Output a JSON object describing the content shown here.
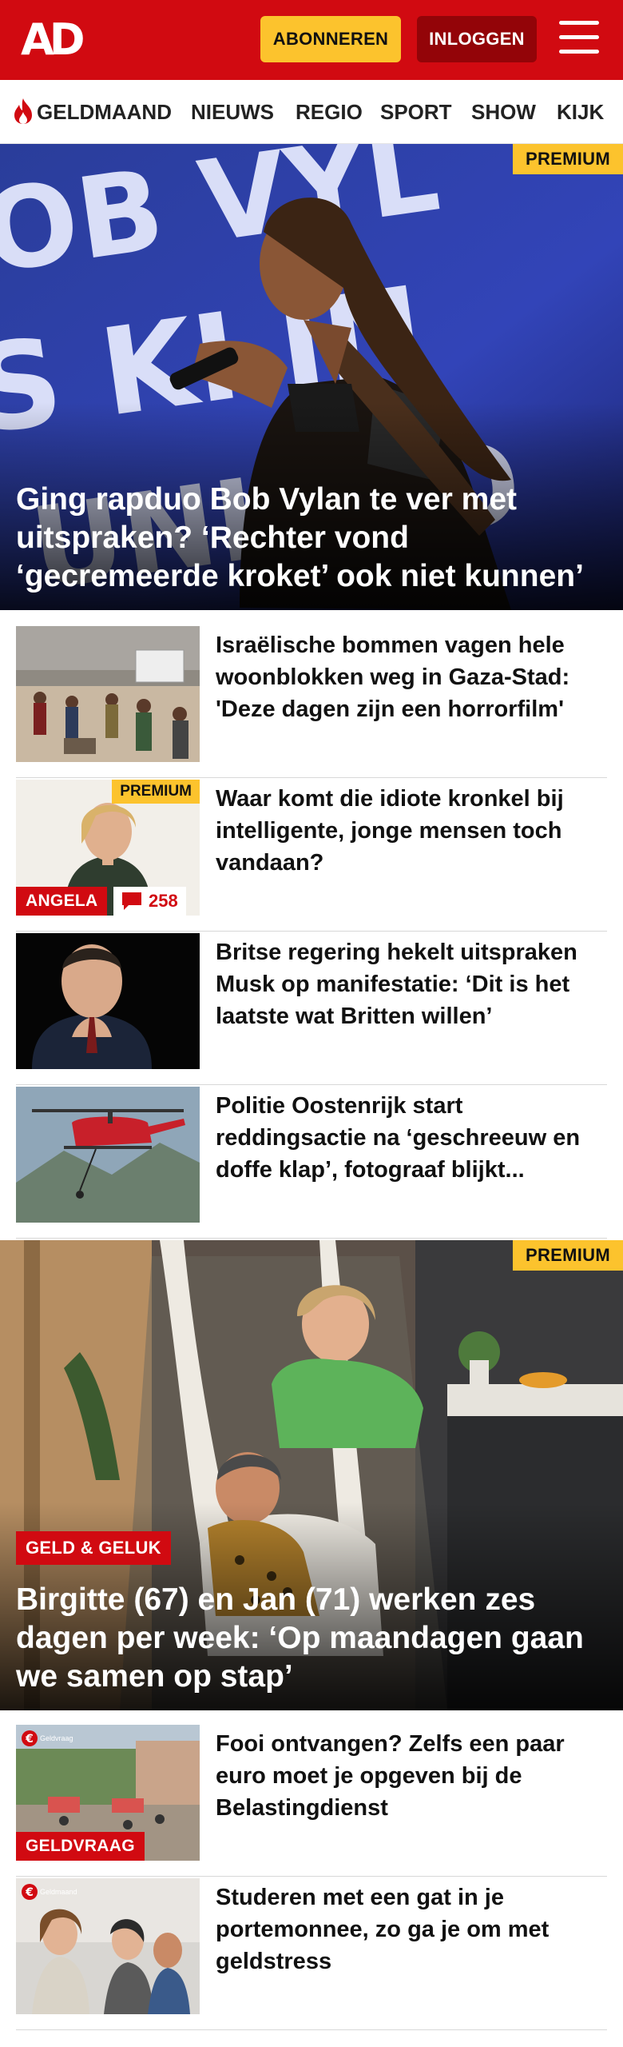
{
  "header": {
    "logo": "AD",
    "subscribe_label": "ABONNEREN",
    "login_label": "INLOGGEN"
  },
  "nav": {
    "items": [
      "GELDMAAND",
      "NIEUWS",
      "REGIO",
      "SPORT",
      "SHOW",
      "KIJK"
    ]
  },
  "hero1": {
    "badge": "PREMIUM",
    "title": "Ging rapduo Bob Vylan te ver met uitspraken? ‘Rechter vond ‘gecremeerde kroket’ ook niet kunnen’",
    "image_text": "BOB VYLAN IS KILLING PUNK ROCK"
  },
  "articles": [
    {
      "title": "Israëlische bommen vagen hele woonblokken weg in Gaza-Stad: 'Deze dagen zijn een horrorfilm'"
    },
    {
      "title": "Waar komt die idiote kronkel bij intelligente, jonge mensen toch vandaan?",
      "badge": "PREMIUM",
      "label": "ANGELA",
      "comments": "258"
    },
    {
      "title": "Britse regering hekelt uitspraken Musk op manifestatie: ‘Dit is het laatste wat Britten willen’"
    },
    {
      "title": "Politie Oostenrijk start reddingsactie na ‘geschreeuw en doffe klap’, fotograaf blijkt..."
    }
  ],
  "hero2": {
    "badge": "PREMIUM",
    "label": "GELD & GELUK",
    "title": "Birgitte (67) en Jan (71) werken zes dagen per week: ‘Op maandagen gaan we samen op stap’"
  },
  "articles2": [
    {
      "title": "Fooi ontvangen? Zelfs een paar euro moet je opgeven bij de Belastingdienst",
      "label": "GELDVRAAG",
      "badge_text": "Geldvraag"
    },
    {
      "title": "Studeren met een gat in je portemonnee, zo ga je om met geldstress",
      "badge_text": "Geldmaand"
    }
  ],
  "colors": {
    "brand_red": "#d10a11",
    "dark_red": "#930408",
    "premium_yellow": "#fcc32d"
  }
}
